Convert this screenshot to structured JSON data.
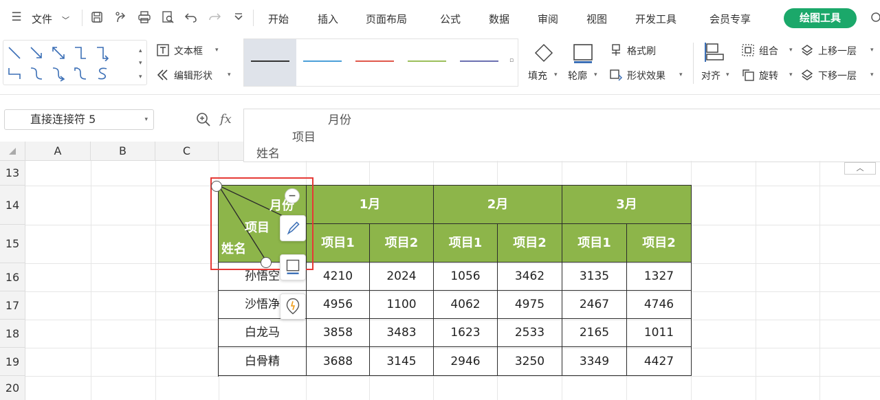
{
  "menubar": {
    "file_label": "文件",
    "tabs": [
      "开始",
      "插入",
      "页面布局",
      "公式",
      "数据",
      "审阅",
      "视图",
      "开发工具",
      "会员专享"
    ],
    "drawing_tools_label": "绘图工具"
  },
  "ribbon": {
    "textbox_label": "文本框",
    "edit_shape_label": "编辑形状",
    "fill_label": "填充",
    "outline_label": "轮廓",
    "format_painter_label": "格式刷",
    "shape_effects_label": "形状效果",
    "align_label": "对齐",
    "group_label": "组合",
    "rotate_label": "旋转",
    "bring_forward_label": "上移一层",
    "send_backward_label": "下移一层",
    "line_colors": [
      "#333333",
      "#4a9fd8",
      "#e0574a",
      "#9bbf5a",
      "#6a6fb0"
    ]
  },
  "formula_bar": {
    "name_box_value": "直接连接符 5",
    "fx_label": "fx",
    "content_line1": "月份",
    "content_line2": "项目",
    "content_line3": "姓名"
  },
  "grid": {
    "columns": [
      "A",
      "B",
      "C"
    ],
    "rows": [
      "13",
      "14",
      "15",
      "16",
      "17",
      "18",
      "19",
      "20"
    ]
  },
  "table": {
    "corner_month": "月份",
    "corner_item": "项目",
    "corner_name": "姓名",
    "months": [
      "1月",
      "2月",
      "3月"
    ],
    "sub_headers": [
      "项目1",
      "项目2",
      "项目1",
      "项目2",
      "项目1",
      "项目2"
    ],
    "rows": [
      {
        "name": "孙悟空",
        "values": [
          "4210",
          "2024",
          "1056",
          "3462",
          "3135",
          "1327"
        ]
      },
      {
        "name": "沙悟净",
        "values": [
          "4956",
          "1100",
          "4062",
          "4975",
          "2467",
          "4746"
        ]
      },
      {
        "name": "白龙马",
        "values": [
          "3858",
          "3483",
          "1623",
          "2533",
          "2165",
          "1011"
        ]
      },
      {
        "name": "白骨精",
        "values": [
          "3688",
          "3145",
          "2946",
          "3250",
          "3349",
          "4427"
        ]
      }
    ],
    "header_color": "#8db54a",
    "selection_color": "#e53935"
  }
}
